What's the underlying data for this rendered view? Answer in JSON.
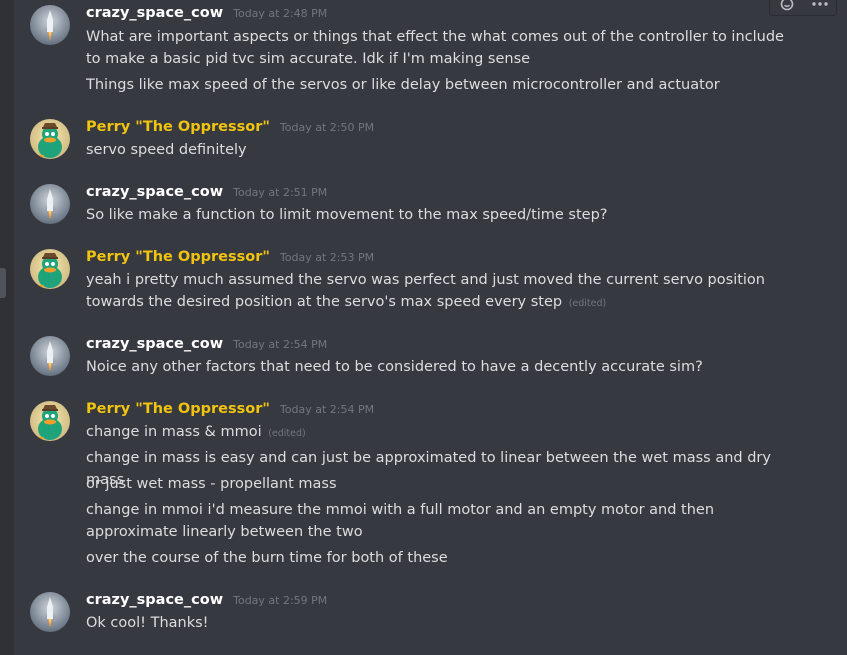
{
  "messages": [
    {
      "author": "crazy_space_cow",
      "timestamp": "Today at 2:48 PM",
      "lines": [
        {
          "text": "What are important aspects  or things that effect the what comes out of the controller to include to make a basic pid tvc sim accurate. Idk if I'm making sense"
        },
        {
          "text": "Things like max speed of the servos or like delay between microcontroller and actuator"
        }
      ]
    },
    {
      "author": "Perry \"The Oppressor\"",
      "timestamp": "Today at 2:50 PM",
      "lines": [
        {
          "text": "servo speed definitely"
        }
      ]
    },
    {
      "author": "crazy_space_cow",
      "timestamp": "Today at 2:51 PM",
      "lines": [
        {
          "text": "So like make a function to limit movement to the max speed/time step?"
        }
      ]
    },
    {
      "author": "Perry \"The Oppressor\"",
      "timestamp": "Today at 2:53 PM",
      "lines": [
        {
          "text": "yeah i pretty much assumed the servo was perfect and just moved the current servo position towards the desired position at the servo's max speed every step",
          "edited": "(edited)"
        }
      ]
    },
    {
      "author": "crazy_space_cow",
      "timestamp": "Today at 2:54 PM",
      "lines": [
        {
          "text": "Noice any other factors that need to be considered to have a decently accurate sim?"
        }
      ]
    },
    {
      "author": "Perry \"The Oppressor\"",
      "timestamp": "Today at 2:54 PM",
      "lines": [
        {
          "text": "change in mass & mmoi",
          "edited": "(edited)"
        },
        {
          "text": "change in mass is easy and can just be approximated to linear between the wet mass and dry mass"
        },
        {
          "text": "or just wet mass - propellant mass"
        },
        {
          "text": "change in mmoi i'd measure the mmoi with a full motor and an empty motor and then approximate linearly between the two"
        },
        {
          "text": "over the course of the burn time for both of these"
        }
      ]
    },
    {
      "author": "crazy_space_cow",
      "timestamp": "Today at 2:59 PM",
      "lines": [
        {
          "text": "Ok cool! Thanks!"
        }
      ]
    }
  ],
  "icons": {
    "toolbar": [
      "add-reaction-icon",
      "more-options-icon"
    ],
    "avatars": {
      "crazy_space_cow": "rocket-avatar",
      "Perry \"The Oppressor\"": "platypus-avatar"
    }
  },
  "colors": {
    "background": "#36393f",
    "text": "#dcddde",
    "username_cow": "#ffffff",
    "username_perry": "#f1c40f",
    "timestamp": "#72767d"
  }
}
